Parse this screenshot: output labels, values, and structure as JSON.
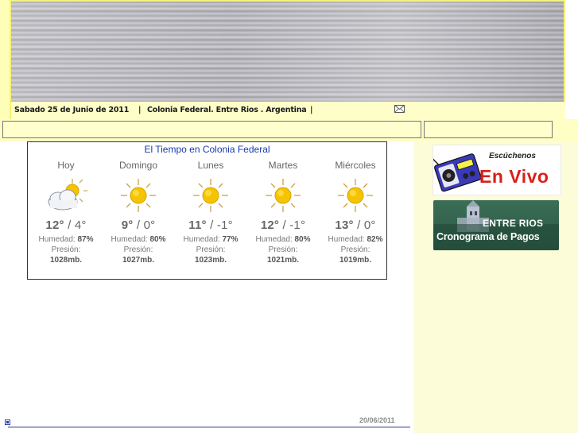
{
  "header": {
    "date": "Sabado 25 de Junio de 2011",
    "separator_1": "|",
    "location": "Colonia Federal. Entre Rios . Argentina",
    "separator_2": "|",
    "mail_icon": "mail-icon"
  },
  "weather": {
    "title": "El Tiempo en Colonia Federal",
    "humidity_label": "Humedad:",
    "pressure_label": "Presión:",
    "days": [
      {
        "name": "Hoy",
        "icon": "partly-cloudy-icon",
        "high": "12°",
        "low": "4°",
        "humidity": "87%",
        "pressure": "1028mb."
      },
      {
        "name": "Domingo",
        "icon": "sun-icon",
        "high": "9°",
        "low": "0°",
        "humidity": "80%",
        "pressure": "1027mb."
      },
      {
        "name": "Lunes",
        "icon": "sun-icon",
        "high": "11°",
        "low": "-1°",
        "humidity": "77%",
        "pressure": "1023mb."
      },
      {
        "name": "Martes",
        "icon": "sun-icon",
        "high": "12°",
        "low": "-1°",
        "humidity": "80%",
        "pressure": "1021mb."
      },
      {
        "name": "Miércoles",
        "icon": "sun-icon",
        "high": "13°",
        "low": "0°",
        "humidity": "82%",
        "pressure": "1019mb."
      }
    ],
    "temp_separator": "/"
  },
  "sidebar": {
    "radio_banner": {
      "line1": "Escúchenos",
      "line2": "En Vivo",
      "icon": "radio-icon"
    },
    "pagos_banner": {
      "line1": "ENTRE RIOS",
      "line2": "Cronograma de Pagos",
      "icon": "building-icon"
    }
  },
  "footer": {
    "date": "20/06/2011"
  },
  "colors": {
    "title_blue": "#1a3aa8",
    "page_yellow": "#fffec9",
    "footer_rule": "#2b3a8c"
  }
}
